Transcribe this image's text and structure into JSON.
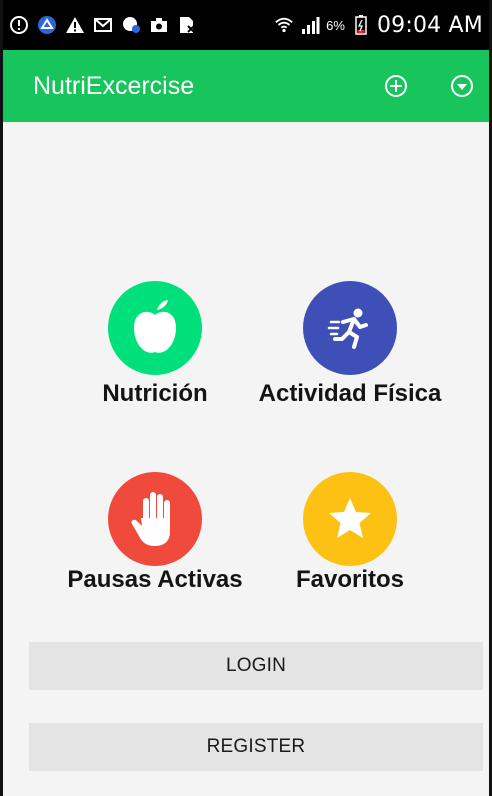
{
  "status_bar": {
    "battery_percent": "6%",
    "time": "09:04 AM",
    "icons": [
      "info-circle-icon",
      "app-logo-icon",
      "warning-icon",
      "mail-icon",
      "voicemail-icon",
      "camera-icon",
      "sim-card-icon",
      "wifi-icon",
      "signal-icon",
      "battery-icon"
    ]
  },
  "app_bar": {
    "title": "NutriExcercise",
    "actions": [
      "add-circle-icon",
      "dropdown-circle-icon"
    ]
  },
  "tiles": [
    {
      "label": "Nutrición",
      "icon": "apple-icon",
      "color": "#00e07a"
    },
    {
      "label": "Actividad Física",
      "icon": "running-person-icon",
      "color": "#3f4fb8"
    },
    {
      "label": "Pausas Activas",
      "icon": "hand-icon",
      "color": "#f04a3c"
    },
    {
      "label": "Favoritos",
      "icon": "star-icon",
      "color": "#fdc113"
    }
  ],
  "buttons": {
    "login": "LOGIN",
    "register": "REGISTER"
  },
  "colors": {
    "app_bar": "#18c55c",
    "background": "#f4f4f4",
    "button": "#e4e4e4"
  }
}
